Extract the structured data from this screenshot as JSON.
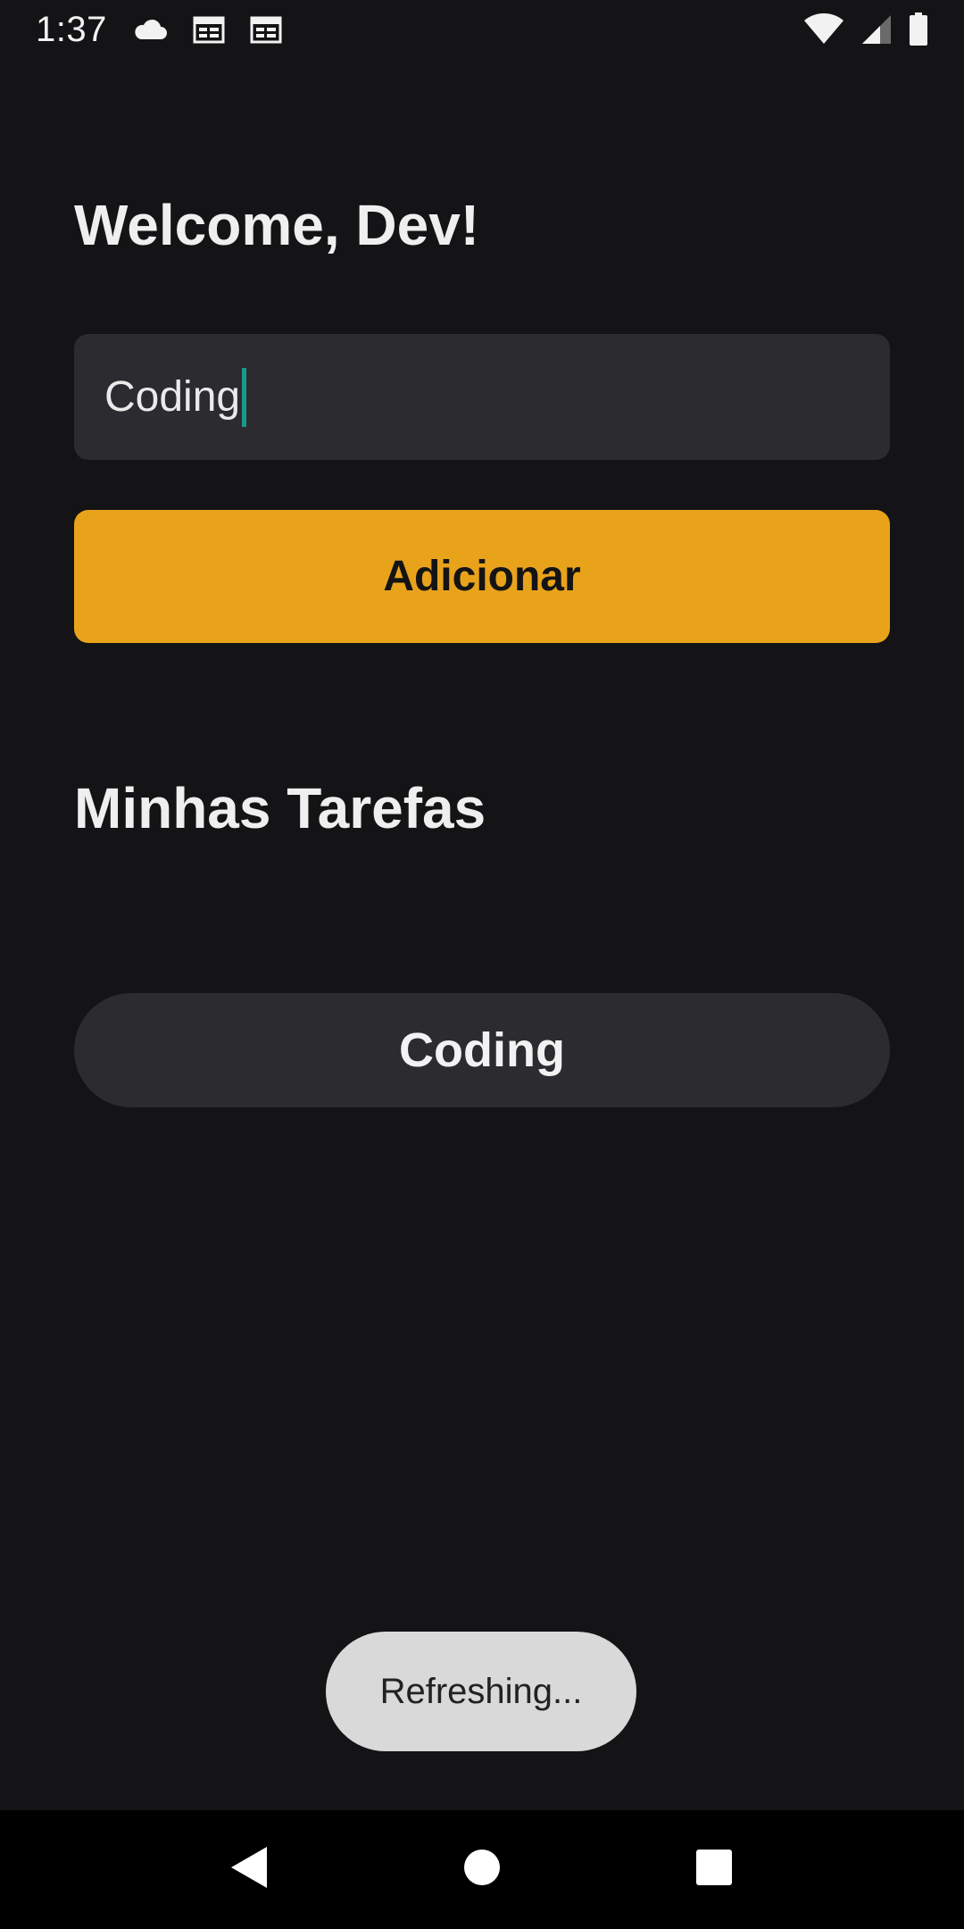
{
  "status_bar": {
    "time": "1:37",
    "left_icons": [
      "cloud-icon",
      "calendar-icon",
      "calendar-icon"
    ],
    "right_icons": [
      "wifi-icon",
      "cell-signal-icon",
      "battery-icon"
    ]
  },
  "header": {
    "welcome": "Welcome, Dev!"
  },
  "task_input": {
    "value": "Coding",
    "caret_color": "#1a9a8a"
  },
  "add_button": {
    "label": "Adicionar",
    "color": "#e9a31b"
  },
  "tasks_section": {
    "title": "Minhas Tarefas",
    "items": [
      {
        "label": "Coding"
      }
    ]
  },
  "toast": {
    "message": "Refreshing..."
  },
  "nav_bar": {
    "buttons": [
      "back-icon",
      "home-icon",
      "recents-icon"
    ]
  },
  "colors": {
    "background": "#141416",
    "surface": "#2b2b30",
    "accent": "#e9a31b"
  }
}
